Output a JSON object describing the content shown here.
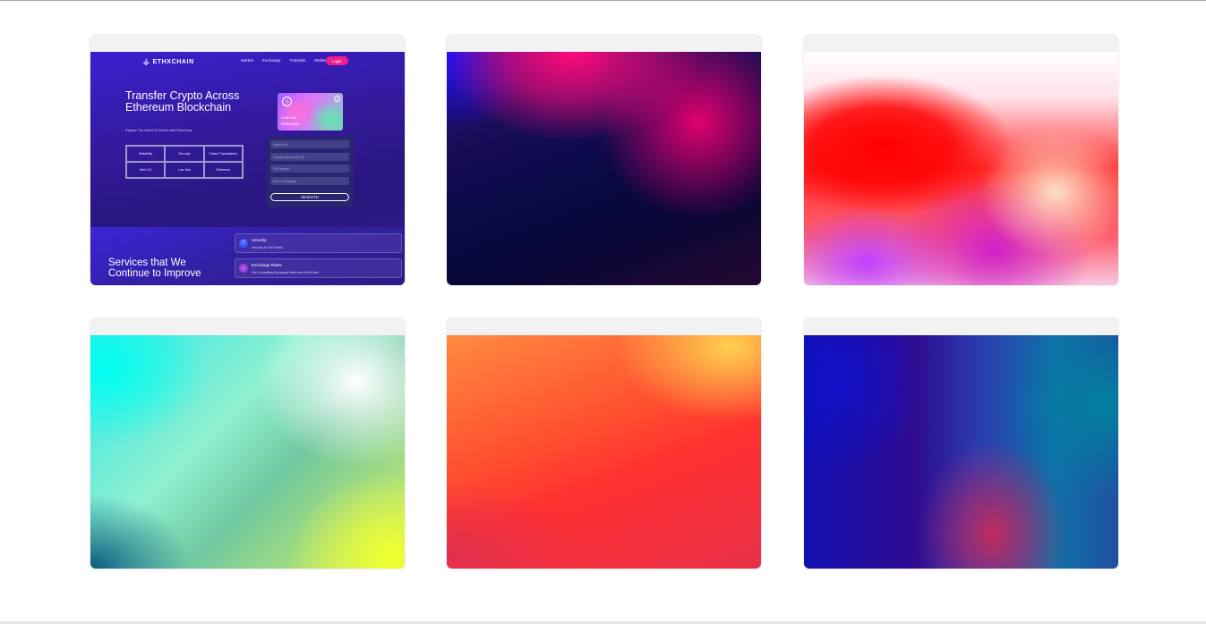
{
  "ethx": {
    "logo_icon": "⚶",
    "logo_text": "ETHXCHAIN",
    "nav": [
      "Market",
      "Exchange",
      "Tutorials",
      "Wallets"
    ],
    "login_label": "Login",
    "hero_title": "Transfer Crypto Across Ethereum Blockchain",
    "hero_sub": "Explore The World Of Ethers with EthxChain",
    "features": [
      "Reliability",
      "Security",
      "Faster Transactions",
      "Web 3.0",
      "Low Gas",
      "Ethereum"
    ],
    "card": {
      "coin_glyph": "◊",
      "info_glyph": "i",
      "address": "0x2f5..9fd4",
      "name": "Ethereum"
    },
    "form": {
      "fields": [
        "Address To",
        "Transfer Amount (ETH)",
        "Gif Keyword",
        "Enter a message"
      ],
      "send_label": "Send ETH"
    },
    "services_title": "Services that We Continue to Improve",
    "services": [
      {
        "icon_glyph": "⛉",
        "icon_color": "#3b5bff",
        "title": "Security",
        "subtitle": "Security Is Our Priority"
      },
      {
        "icon_glyph": "⌕",
        "icon_color": "#a040e0",
        "title": "Exchange Rates",
        "subtitle": "Get Compelling Exchange Rates with EthxChain"
      }
    ]
  }
}
